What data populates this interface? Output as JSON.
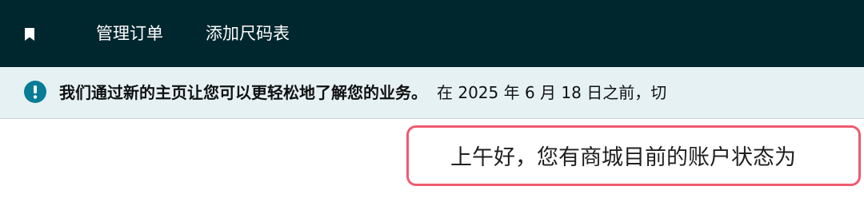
{
  "nav": {
    "bookmark_icon": "bookmark-icon",
    "items": [
      {
        "label": "管理订单"
      },
      {
        "label": "添加尺码表"
      }
    ],
    "bg_color": "#00262e"
  },
  "banner": {
    "icon": "info-icon",
    "icon_color": "#087b95",
    "bold_text": "我们通过新的主页让您可以更轻松地了解您的业务。",
    "normal_text": "在 2025 年 6 月 18 日之前，切",
    "bg_color": "#e6f1f4"
  },
  "greeting": {
    "text": "上午好，您有商城目前的账户状态为",
    "highlight_color": "#ee5a6e"
  }
}
